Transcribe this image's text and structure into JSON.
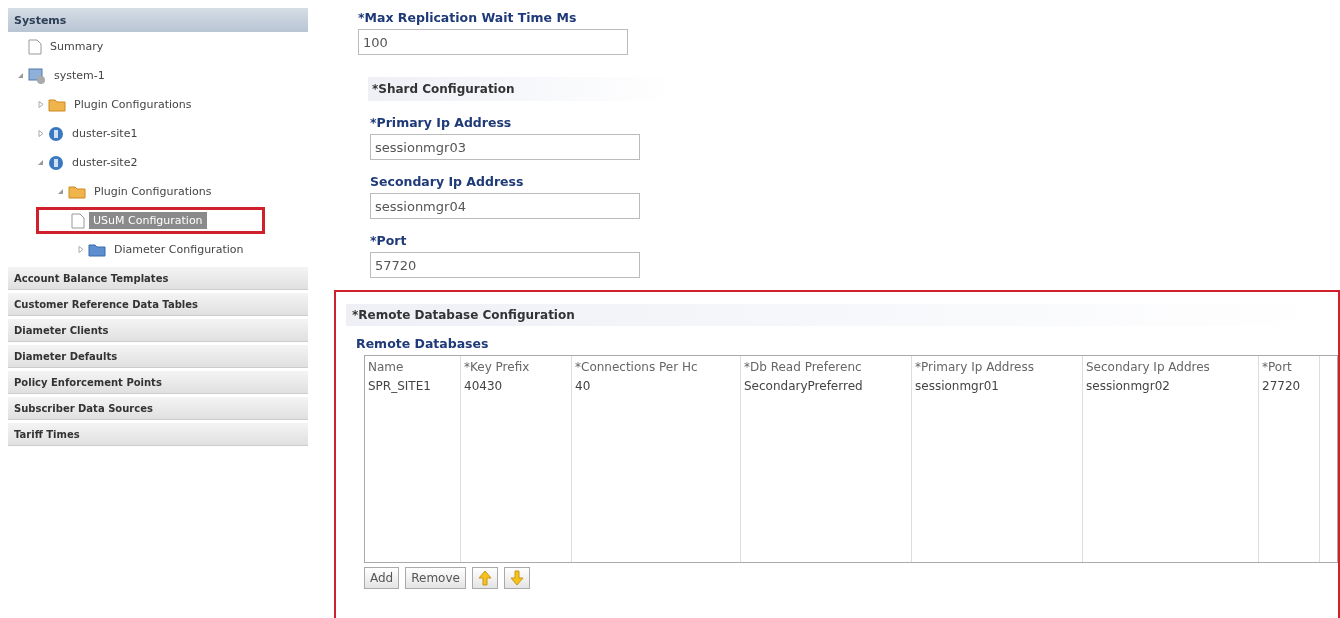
{
  "sidebar": {
    "header": "Systems",
    "tree": [
      {
        "label": "Summary",
        "kind": "doc",
        "selected": false
      },
      {
        "label": "system-1",
        "kind": "system",
        "expanded": true,
        "selected": false,
        "children": [
          {
            "label": "Plugin Configurations",
            "kind": "folder",
            "expanded": false,
            "selected": false
          },
          {
            "label": "duster-site1",
            "kind": "cluster",
            "expanded": false,
            "selected": false
          },
          {
            "label": "duster-site2",
            "kind": "cluster",
            "expanded": true,
            "selected": false,
            "children": [
              {
                "label": "Plugin Configurations",
                "kind": "folder",
                "expanded": true,
                "selected": false,
                "children": [
                  {
                    "label": "USuM Configuration",
                    "kind": "doc",
                    "selected": true,
                    "highlighted": true
                  },
                  {
                    "label": "Diameter Configuration",
                    "kind": "bluefolder",
                    "expanded": false,
                    "selected": false
                  }
                ]
              }
            ]
          }
        ]
      }
    ],
    "sections": [
      "Account Balance Templates",
      "Customer Reference Data Tables",
      "Diameter Clients",
      "Diameter Defaults",
      "Policy Enforcement Points",
      "Subscriber Data Sources",
      "Tariff Times"
    ]
  },
  "form": {
    "max_replication": {
      "label": "*Max Replication Wait Time Ms",
      "value": "100"
    },
    "shard": {
      "title": "*Shard Configuration",
      "fields": [
        {
          "label": "*Primary Ip Address",
          "value": "sessionmgr03"
        },
        {
          "label": "Secondary Ip Address",
          "value": "sessionmgr04"
        },
        {
          "label": "*Port",
          "value": "57720"
        }
      ]
    },
    "remote": {
      "title": "*Remote Database Configuration",
      "highlighted": true,
      "table_title": "Remote Databases",
      "columns": [
        "Name",
        "*Key Prefix",
        "*Connections Per Hc",
        "*Db Read Preferenc",
        "*Primary Ip Address",
        "Secondary Ip Addres",
        "*Port"
      ],
      "rows": [
        [
          "SPR_SITE1",
          "40430",
          "40",
          "SecondaryPreferred",
          "sessionmgr01",
          "sessionmgr02",
          "27720"
        ]
      ],
      "buttons": [
        {
          "kind": "text",
          "label": "Add"
        },
        {
          "kind": "text",
          "label": "Remove"
        },
        {
          "kind": "up"
        },
        {
          "kind": "down"
        }
      ]
    }
  }
}
